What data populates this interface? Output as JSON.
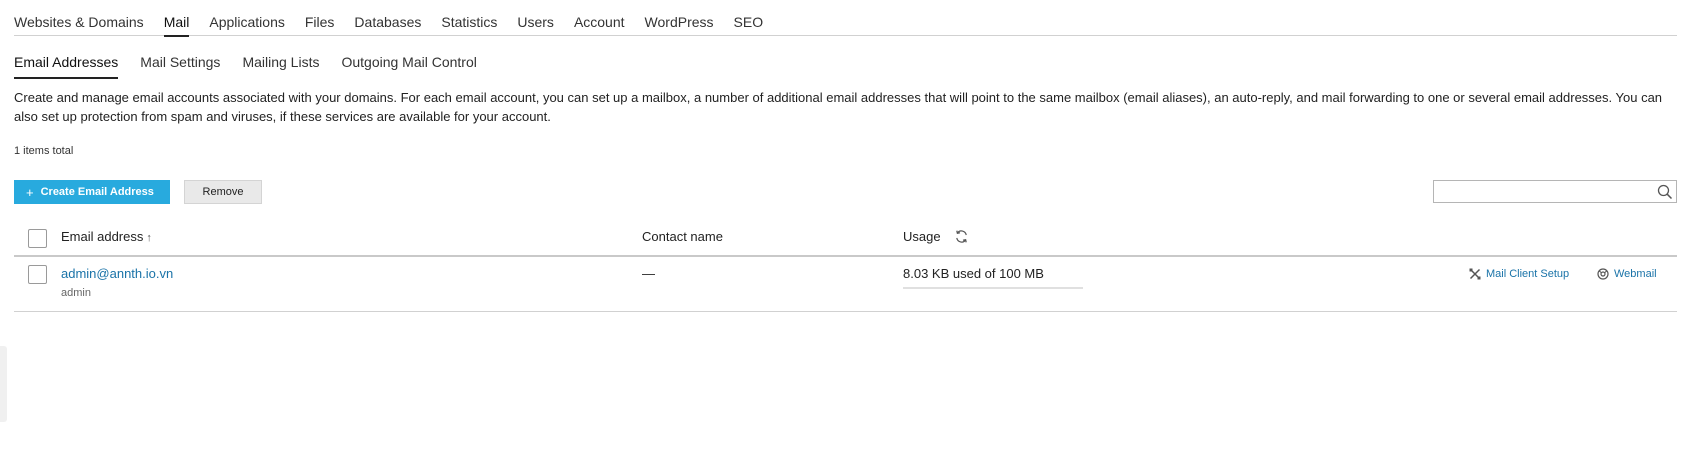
{
  "main_tabs": [
    "Websites & Domains",
    "Mail",
    "Applications",
    "Files",
    "Databases",
    "Statistics",
    "Users",
    "Account",
    "WordPress",
    "SEO"
  ],
  "main_tab_active": "Mail",
  "sub_tabs": [
    "Email Addresses",
    "Mail Settings",
    "Mailing Lists",
    "Outgoing Mail Control"
  ],
  "sub_tab_active": "Email Addresses",
  "description": "Create and manage email accounts associated with your domains. For each email account, you can set up a mailbox, a number of additional email addresses that will point to the same mailbox (email aliases), an auto-reply, and mail forwarding to one or several email addresses. You can also set up protection from spam and viruses, if these services are available for your account.",
  "items_total": "1 items total",
  "toolbar": {
    "create_label": "Create Email Address",
    "remove_label": "Remove",
    "search_placeholder": ""
  },
  "table": {
    "col_email": "Email address",
    "col_email_sort": "↑",
    "col_contact": "Contact name",
    "col_usage": "Usage",
    "rows": [
      {
        "email": "admin@annth.io.vn",
        "sub": "admin",
        "contact": "—",
        "usage": "8.03 KB used of 100 MB",
        "usage_fraction": 0.0001,
        "action_setup": "Mail Client Setup",
        "action_webmail": "Webmail"
      }
    ]
  },
  "colors": {
    "accent": "#28aade",
    "link": "#1a73a8"
  }
}
